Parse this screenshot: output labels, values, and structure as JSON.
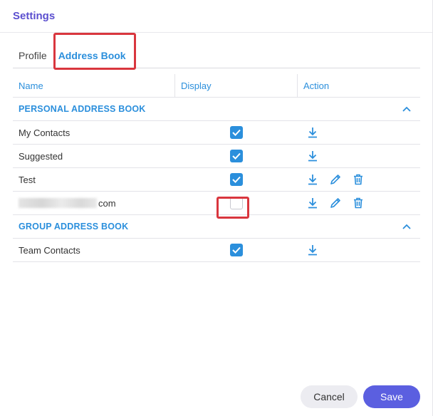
{
  "header": {
    "title": "Settings"
  },
  "tabs": [
    {
      "label": "Profile",
      "active": false
    },
    {
      "label": "Address Book",
      "active": true
    }
  ],
  "table": {
    "columns": [
      "Name",
      "Display",
      "Action"
    ],
    "groups": [
      {
        "label": "PERSONAL ADDRESS BOOK",
        "collapse_icon": "chevron-up-icon",
        "rows": [
          {
            "name": "My Contacts",
            "display": true,
            "actions": [
              "download-icon"
            ]
          },
          {
            "name": "Suggested",
            "display": true,
            "actions": [
              "download-icon"
            ]
          },
          {
            "name": "Test",
            "display": true,
            "actions": [
              "download-icon",
              "pencil-icon",
              "trash-icon"
            ]
          },
          {
            "name": "com",
            "name_prefix_redacted": true,
            "display": false,
            "actions": [
              "download-icon",
              "pencil-icon",
              "trash-icon"
            ]
          }
        ]
      },
      {
        "label": "GROUP ADDRESS BOOK",
        "collapse_icon": "chevron-up-icon",
        "rows": [
          {
            "name": "Team Contacts",
            "display": true,
            "actions": [
              "download-icon"
            ]
          }
        ]
      }
    ]
  },
  "footer": {
    "cancel_label": "Cancel",
    "save_label": "Save"
  },
  "colors": {
    "accent": "#2b8fdc",
    "title": "#5b4fcf",
    "save_button": "#5b5fe0",
    "highlight": "#d9363e"
  }
}
